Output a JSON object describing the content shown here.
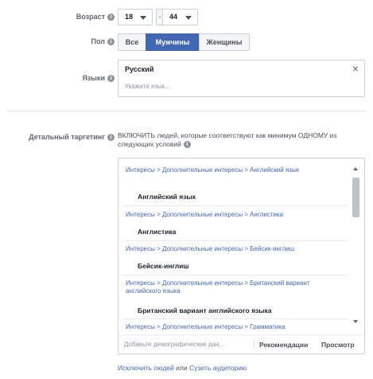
{
  "age": {
    "label": "Возраст",
    "min": "18",
    "max": "44",
    "dash": "-"
  },
  "gender": {
    "label": "Пол",
    "options": [
      "Все",
      "Мужчины",
      "Женщины"
    ],
    "selected": "Мужчины"
  },
  "languages": {
    "label": "Языки",
    "value": "Русский",
    "placeholder": "Укажите язык..."
  },
  "detailed": {
    "label": "Детальный таргетинг",
    "description": "ВКЛЮЧИТЬ людей, которые соответствуют как минимум ОДНОМУ из следующих условий",
    "items": [
      {
        "path": "Интересы > Дополнительные интересы > Английский язык",
        "name": "Английский язык"
      },
      {
        "path": "Интересы > Дополнительные интересы > Англистика",
        "name": "Англистика"
      },
      {
        "path": "Интересы > Дополнительные интересы > Бейсик-инглиш",
        "name": "Бейсик-инглиш"
      },
      {
        "path": "Интересы > Дополнительные интересы > Британский вариант английского языка",
        "name": "Британский вариант английского языка"
      },
      {
        "path": "Интересы > Дополнительные интересы > Грамматика",
        "name": ""
      }
    ],
    "input_placeholder": "Добавьте демографические дан...",
    "recommendations": "Рекомендации",
    "browse": "Просмотр"
  },
  "footer": {
    "exclude": "Исключить людей",
    "or": "или",
    "narrow": "Сузить аудиторию"
  }
}
